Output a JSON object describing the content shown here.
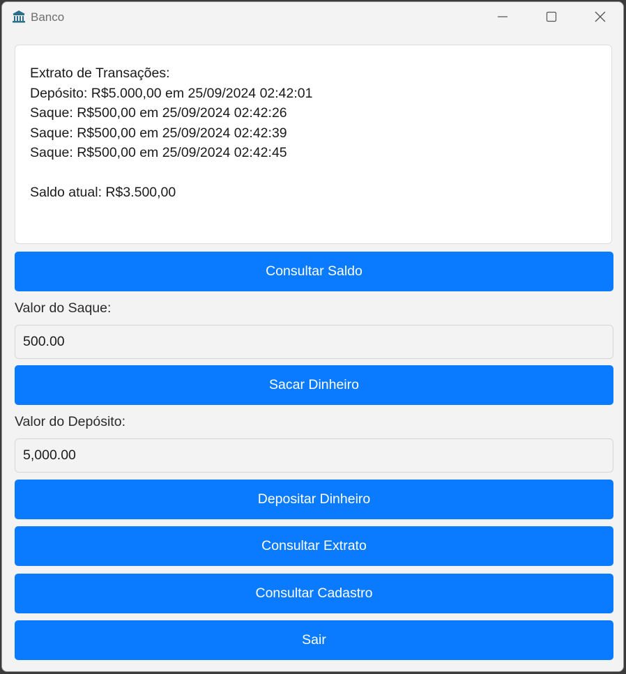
{
  "window": {
    "title": "Banco",
    "app_icon": "bank-icon",
    "controls": [
      "minimize-icon",
      "maximize-icon",
      "close-icon"
    ]
  },
  "statement": {
    "lines": [
      "Extrato de Transações:",
      "Depósito: R$5.000,00 em 25/09/2024 02:42:01",
      "Saque: R$500,00 em 25/09/2024 02:42:26",
      "Saque: R$500,00 em 25/09/2024 02:42:39",
      "Saque: R$500,00 em 25/09/2024 02:42:45"
    ],
    "balance_line": "Saldo atual: R$3.500,00"
  },
  "buttons": {
    "check_balance": "Consultar Saldo",
    "withdraw": "Sacar Dinheiro",
    "deposit": "Depositar Dinheiro",
    "statement": "Consultar Extrato",
    "registration": "Consultar Cadastro",
    "exit": "Sair"
  },
  "withdraw_field": {
    "label": "Valor do Saque:",
    "value": "500.00"
  },
  "deposit_field": {
    "label": "Valor do Depósito:",
    "value": "5,000.00"
  },
  "colors": {
    "button_primary": "#0a7bff",
    "window_bg": "#f3f3f3",
    "statement_bg": "#ffffff"
  }
}
